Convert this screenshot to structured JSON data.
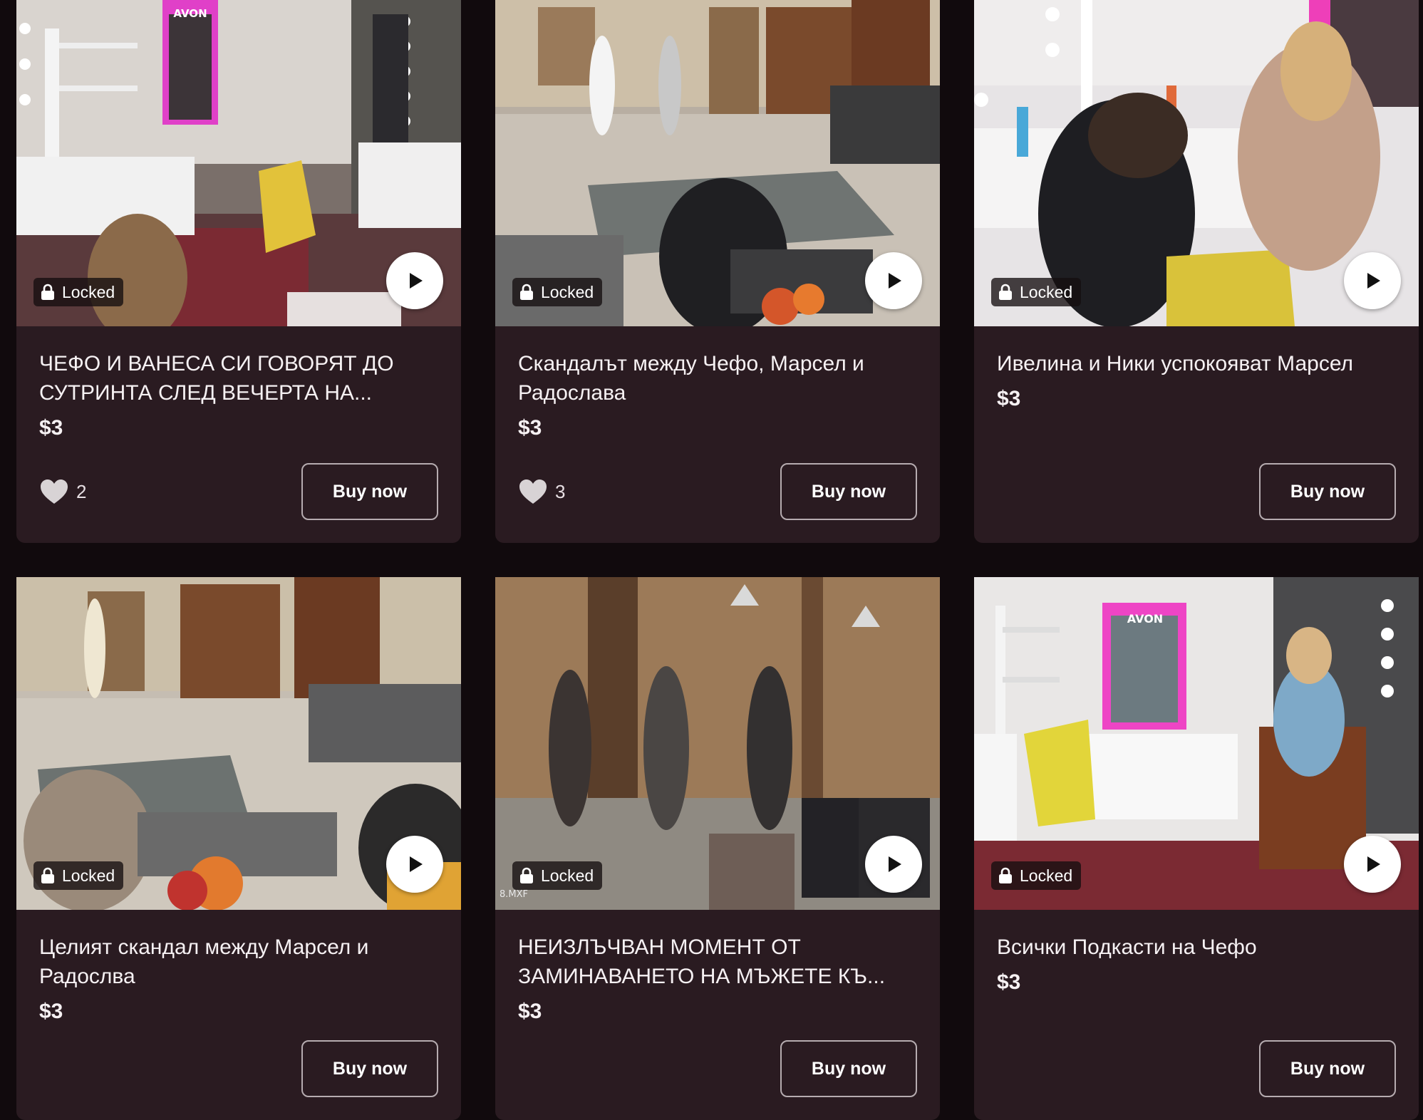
{
  "colors": {
    "page_bg": "#110a0d",
    "card_bg": "#2a1b21",
    "text": "#f6f1f3",
    "button_border": "#b6acb0"
  },
  "icons": {
    "lock": "lock-icon",
    "play": "play-icon",
    "heart": "heart-icon"
  },
  "cards": [
    {
      "title": "ЧЕФО И ВАНЕСА СИ ГОВОРЯТ ДО СУТРИНТА СЛЕД ВЕЧЕРТА НА...",
      "price": "$3",
      "locked_label": "Locked",
      "likes": "2",
      "buy_label": "Buy now",
      "thumb_text": "AVON"
    },
    {
      "title": "Скандалът между Чефо, Марсел и Радослава",
      "price": "$3",
      "locked_label": "Locked",
      "likes": "3",
      "buy_label": "Buy now"
    },
    {
      "title": "Ивелина и Ники успокояват Марсел",
      "price": "$3",
      "locked_label": "Locked",
      "likes": "",
      "buy_label": "Buy now"
    },
    {
      "title": "Целият скандал между Марсел и Радослва",
      "price": "$3",
      "locked_label": "Locked",
      "likes": "",
      "buy_label": "Buy now"
    },
    {
      "title": "НЕИЗЛЪЧВАН МОМЕНТ ОТ ЗАМИНАВАНЕТО НА МЪЖЕТЕ КЪ...",
      "price": "$3",
      "locked_label": "Locked",
      "likes": "",
      "buy_label": "Buy now",
      "thumb_text": "8.MXF"
    },
    {
      "title": "Всички Подкасти на Чефо",
      "price": "$3",
      "locked_label": "Locked",
      "likes": "",
      "buy_label": "Buy now",
      "thumb_text": "AVON"
    }
  ]
}
